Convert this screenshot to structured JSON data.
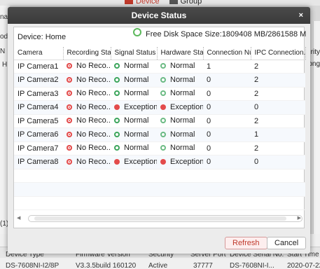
{
  "bg": {
    "tabs": [
      {
        "label": "Device"
      },
      {
        "label": "Group"
      }
    ],
    "left_labels": [
      "nag",
      "odi",
      "N",
      "H",
      "(1)"
    ],
    "right_labels": [
      "curity",
      "rong"
    ],
    "bottom_headers": [
      "Device Type",
      "Firmware Version",
      "Security",
      "Server Port",
      "Device Serial No.",
      "Start Time"
    ],
    "bottom_values": [
      "DS-7608NI-I2/8P",
      "V3.3.5build 160120",
      "Active",
      "37777",
      "DS-7608NI-I...",
      "2020-07-22 0"
    ]
  },
  "dialog": {
    "title": "Device Status",
    "close_label": "×",
    "device_label": "Device: Home",
    "disk_text": "Free Disk Space Size:1809408 MB/2861588 M",
    "columns": [
      "Camera",
      "Recording Status",
      "Signal Status",
      "Hardware Status",
      "Connection Nu...",
      "IPC Connection..."
    ],
    "rows": [
      {
        "camera": "IP Camera1",
        "rec": "No Reco...",
        "signal": "Normal",
        "hardware": "Normal",
        "conn": "1",
        "ipc": "2"
      },
      {
        "camera": "IP Camera2",
        "rec": "No Reco...",
        "signal": "Normal",
        "hardware": "Normal",
        "conn": "0",
        "ipc": "2"
      },
      {
        "camera": "IP Camera3",
        "rec": "No Reco...",
        "signal": "Normal",
        "hardware": "Normal",
        "conn": "0",
        "ipc": "2"
      },
      {
        "camera": "IP Camera4",
        "rec": "No Reco...",
        "signal": "Exception",
        "hardware": "Exception",
        "conn": "0",
        "ipc": "0"
      },
      {
        "camera": "IP Camera5",
        "rec": "No Reco...",
        "signal": "Normal",
        "hardware": "Normal",
        "conn": "0",
        "ipc": "2"
      },
      {
        "camera": "IP Camera6",
        "rec": "No Reco...",
        "signal": "Normal",
        "hardware": "Normal",
        "conn": "0",
        "ipc": "1"
      },
      {
        "camera": "IP Camera7",
        "rec": "No Reco...",
        "signal": "Normal",
        "hardware": "Normal",
        "conn": "0",
        "ipc": "2"
      },
      {
        "camera": "IP Camera8",
        "rec": "No Reco...",
        "signal": "Exception",
        "hardware": "Exception",
        "conn": "0",
        "ipc": "0"
      }
    ],
    "refresh_label": "Refresh",
    "cancel_label": "Cancel"
  },
  "colors": {
    "accent": "#c0392b",
    "ok": "#3ca55c",
    "error": "#e34b4b"
  }
}
